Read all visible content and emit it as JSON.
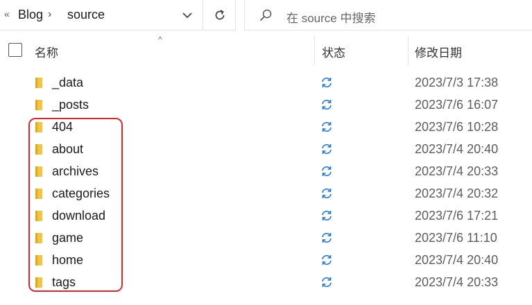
{
  "breadcrumb": {
    "overflow": "«",
    "items": [
      "Blog",
      "source"
    ],
    "separator": "›"
  },
  "search": {
    "placeholder": "在 source 中搜索"
  },
  "columns": {
    "name": "名称",
    "status": "状态",
    "modified": "修改日期"
  },
  "colors": {
    "folder": "#f5c542",
    "sync": "#1a73d9",
    "highlight": "#e0262a"
  },
  "files": [
    {
      "name": "_data",
      "date": "2023/7/3 17:38"
    },
    {
      "name": "_posts",
      "date": "2023/7/6 16:07"
    },
    {
      "name": "404",
      "date": "2023/7/6 10:28"
    },
    {
      "name": "about",
      "date": "2023/7/4 20:40"
    },
    {
      "name": "archives",
      "date": "2023/7/4 20:33"
    },
    {
      "name": "categories",
      "date": "2023/7/4 20:32"
    },
    {
      "name": "download",
      "date": "2023/7/6 17:21"
    },
    {
      "name": "game",
      "date": "2023/7/6 11:10"
    },
    {
      "name": "home",
      "date": "2023/7/4 20:40"
    },
    {
      "name": "tags",
      "date": "2023/7/4 20:33"
    }
  ]
}
